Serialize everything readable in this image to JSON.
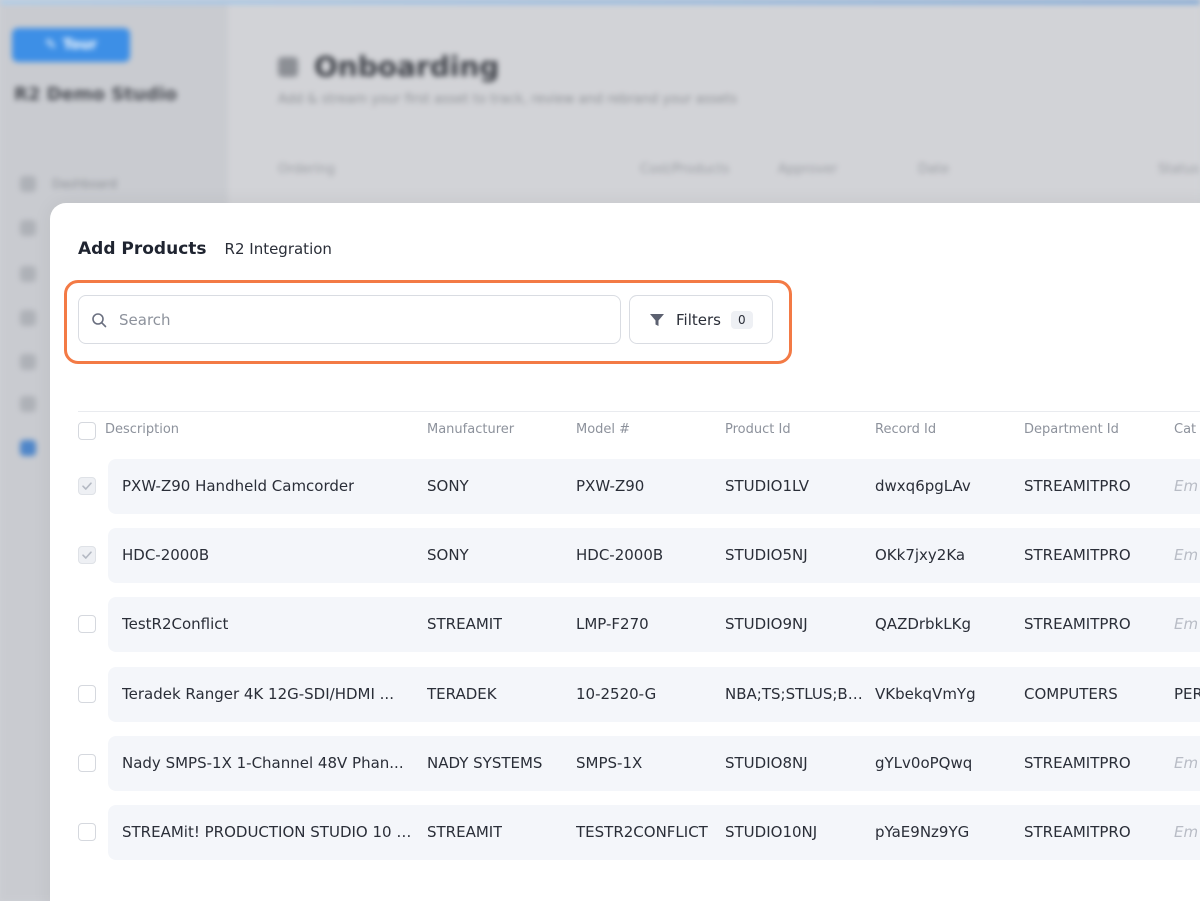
{
  "background": {
    "logo_text": "Tour",
    "studio_name": "R2 Demo Studio",
    "nav_items": [
      "Dashboard",
      "",
      "",
      "",
      "",
      "",
      ""
    ],
    "page_title": "Onboarding",
    "page_subtitle": "Add & stream your first asset to track, review and rebrand your assets",
    "table_headers": [
      "Ordering",
      "Cost/Products",
      "Approver",
      "Date",
      "Status"
    ]
  },
  "modal": {
    "tabs": {
      "active": "Add Products",
      "secondary": "R2 Integration"
    },
    "search": {
      "placeholder": "Search",
      "value": ""
    },
    "filters": {
      "label": "Filters",
      "count": "0"
    },
    "columns": [
      "Description",
      "Manufacturer",
      "Model #",
      "Product Id",
      "Record Id",
      "Department Id",
      "Cat"
    ],
    "rows": [
      {
        "checked": true,
        "description": "PXW-Z90 Handheld Camcorder",
        "manufacturer": "SONY",
        "model": "PXW-Z90",
        "product_id": "STUDIO1LV",
        "record_id": "dwxq6pgLAv",
        "department_id": "STREAMITPRO",
        "category": "Em",
        "category_muted": true
      },
      {
        "checked": true,
        "description": "HDC-2000B",
        "manufacturer": "SONY",
        "model": "HDC-2000B",
        "product_id": "STUDIO5NJ",
        "record_id": "OKk7jxy2Ka",
        "department_id": "STREAMITPRO",
        "category": "Em",
        "category_muted": true
      },
      {
        "checked": false,
        "description": "TestR2Conflict",
        "manufacturer": "STREAMIT",
        "model": "LMP-F270",
        "product_id": "STUDIO9NJ",
        "record_id": "QAZDrbkLKg",
        "department_id": "STREAMITPRO",
        "category": "Em",
        "category_muted": true
      },
      {
        "checked": false,
        "description": "Teradek Ranger 4K 12G-SDI/HDMI ...",
        "manufacturer": "TERADEK",
        "model": "10-2520-G",
        "product_id": "NBA;TS;STLUS;BL...",
        "record_id": "VKbekqVmYg",
        "department_id": "COMPUTERS",
        "category": "PER",
        "category_muted": false
      },
      {
        "checked": false,
        "description": "Nady SMPS-1X 1-Channel 48V Phan...",
        "manufacturer": "NADY SYSTEMS",
        "model": "SMPS-1X",
        "product_id": "STUDIO8NJ",
        "record_id": "gYLv0oPQwq",
        "department_id": "STREAMITPRO",
        "category": "Em",
        "category_muted": true
      },
      {
        "checked": false,
        "description": "STREAMit! PRODUCTION STUDIO 10 (...",
        "manufacturer": "STREAMIT",
        "model": "TESTR2CONFLICT",
        "product_id": "STUDIO10NJ",
        "record_id": "pYaE9Nz9YG",
        "department_id": "STREAMITPRO",
        "category": "Em",
        "category_muted": true
      }
    ]
  },
  "colors": {
    "highlight": "#f37a45",
    "row_bg": "#f4f6fa",
    "logo_bg": "#3d8fe6"
  }
}
